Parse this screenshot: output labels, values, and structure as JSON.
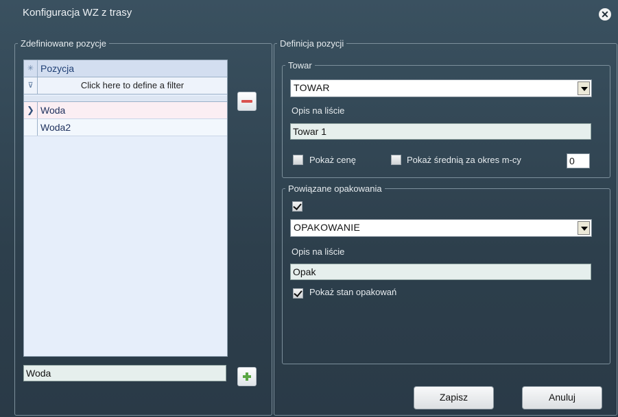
{
  "window": {
    "title": "Konfiguracja WZ z trasy"
  },
  "left_panel": {
    "legend": "Zdefiniowane pozycje",
    "grid": {
      "column_header": "Pozycja",
      "filter_text": "Click here to define a filter",
      "rows": [
        {
          "label": "Woda",
          "selected": true
        },
        {
          "label": "Woda2",
          "selected": false
        }
      ]
    },
    "new_item_value": "Woda"
  },
  "right_panel": {
    "legend": "Definicja pozycji",
    "towar": {
      "legend": "Towar",
      "combo_value": "TOWAR",
      "opis_label": "Opis na liście",
      "opis_value": "Towar 1",
      "pokaz_cene_label": "Pokaż cenę",
      "pokaz_cene_checked": false,
      "pokaz_srednia_label": "Pokaż średnią za okres m-cy",
      "pokaz_srednia_checked": false,
      "okres_value": "0"
    },
    "opakowania": {
      "legend": "Powiązane opakowania",
      "enabled_checked": true,
      "combo_value": "OPAKOWANIE",
      "opis_label": "Opis na liście",
      "opis_value": "Opak",
      "pokaz_stan_label": "Pokaż stan opakowań",
      "pokaz_stan_checked": true
    }
  },
  "buttons": {
    "save": "Zapisz",
    "cancel": "Anuluj"
  }
}
